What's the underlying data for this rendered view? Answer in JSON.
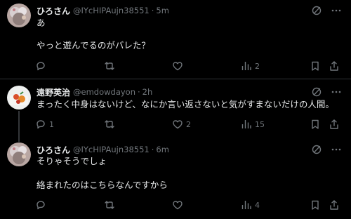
{
  "posts": [
    {
      "name": "ひろさん",
      "handle": "@IYcHIPAujn38551",
      "separator": "·",
      "time": "5m",
      "lines": [
        "あ",
        "",
        "やっと遊んでるのがバレた？"
      ],
      "reply_count": "",
      "retweet_count": "",
      "like_count": "",
      "views": "2"
    },
    {
      "name": "遠野英治",
      "handle": "@emdowdayon",
      "separator": "·",
      "time": "2h",
      "lines": [
        "まったく中身はないけど、なにか言い返さないと気がすまないだけの人間。"
      ],
      "reply_count": "1",
      "retweet_count": "",
      "like_count": "2",
      "views": "15"
    },
    {
      "name": "ひろさん",
      "handle": "@IYcHIPAujn38551",
      "separator": "·",
      "time": "6m",
      "lines": [
        "そりゃそうでしょ",
        "",
        "絡まれたのはこちらなんですから"
      ],
      "reply_count": "",
      "retweet_count": "",
      "like_count": "",
      "views": "4"
    }
  ],
  "icons": {
    "grok": "grok-icon",
    "more": "more-icon",
    "reply": "reply-icon",
    "retweet": "retweet-icon",
    "like": "like-icon",
    "views": "views-icon",
    "bookmark": "bookmark-icon",
    "share": "share-icon"
  },
  "colors": {
    "background": "#000000",
    "text": "#e7e9ea",
    "muted": "#71767b",
    "divider": "#2f3336"
  }
}
